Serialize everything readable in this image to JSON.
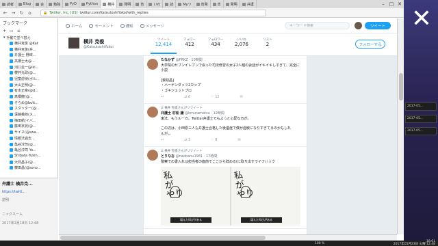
{
  "browser": {
    "tabs": [
      {
        "label": "読者"
      },
      {
        "label": "Blog"
      },
      {
        "label": "会"
      },
      {
        "label": "勉強"
      },
      {
        "label": "PyD"
      },
      {
        "label": "Python"
      },
      {
        "label": "横井"
      },
      {
        "label": "発明"
      },
      {
        "label": "告"
      },
      {
        "label": "いわ"
      },
      {
        "label": "読"
      },
      {
        "label": "Myツ"
      },
      {
        "label": "告発"
      },
      {
        "label": "告"
      },
      {
        "label": "発明"
      },
      {
        "label": "弁護"
      }
    ],
    "url_site": "Twitter, Inc. [US]",
    "url_path": "twitter.com/KatsutoshiYokoi/with_replies"
  },
  "sidebar": {
    "title": "ブックマーク",
    "folder": "手動で並べ替え",
    "items": [
      {
        "label": "横井克俊 @Kat"
      },
      {
        "label": "横井克俊(弁..."
      },
      {
        "label": "弁護士 野田..."
      },
      {
        "label": "高橋士大@..."
      },
      {
        "label": "河口圭一@iki..."
      },
      {
        "label": "櫻井光政(@..."
      },
      {
        "label": "児童虐待(ボル..."
      },
      {
        "label": "大山正明(@..."
      },
      {
        "label": "有本正章(@d..."
      },
      {
        "label": "高橋龍(@..."
      },
      {
        "label": "そらめ@butt..."
      },
      {
        "label": "スタッター(@..."
      },
      {
        "label": "遠藤義郎(ス..."
      },
      {
        "label": "梅田航(イバ..."
      },
      {
        "label": "藤田京晃(@..."
      },
      {
        "label": "サイネ(@swa..."
      },
      {
        "label": "情報法過去..."
      },
      {
        "label": "亀谷淳司(@..."
      },
      {
        "label": "亀谷淳司 Yo..."
      },
      {
        "label": "Shibata Yukin..."
      },
      {
        "label": "大月昌子(@..."
      },
      {
        "label": "藤田昌(@sono..."
      }
    ],
    "panel_title": "弁護士 横井克...",
    "panel_link": "https://twitt...",
    "panel_label1": "説明",
    "panel_label2": "ニックネーム",
    "panel_date": "2017年2月18日 12:48"
  },
  "twitter": {
    "nav_home": "ホーム",
    "nav_moments": "モーメント",
    "nav_notifications": "通知",
    "nav_messages": "メッセージ",
    "search_placeholder": "キーワード検索",
    "tweet_button": "ツイート",
    "profile_name": "横井 克俊",
    "profile_handle": "@KatsutoshiYokoi",
    "stats": [
      {
        "label": "ツイート",
        "value": "12,414"
      },
      {
        "label": "フォロー",
        "value": "412"
      },
      {
        "label": "フォロワー",
        "value": "434"
      },
      {
        "label": "いいね",
        "value": "2,076"
      },
      {
        "label": "リスト",
        "value": "2"
      }
    ],
    "follow_button": "フォローする"
  },
  "tweets": [
    {
      "rt": "",
      "name": "たなかず",
      "handle": "@FRKZ · 10時間",
      "lines": [
        "大学院のセブンイレブンで会った司法修習の女子2人組の会話がイキイキしすぎて、完全に小説",
        "",
        "[救助品]",
        "・ハーゲンダッツ2カップ",
        "・ゴキジェットプロ"
      ],
      "counts": [
        "",
        "6",
        "12"
      ]
    },
    {
      "rt": "横井 克俊さんがリツイート",
      "name": "弁護士 村松 謙",
      "handle": "@kmuramatsu · 12時間",
      "lines": [
        "東法、もうルーカ。Twitter弁護士でもよっと心配な方が。",
        "",
        "この辺は、小田原三人も弁護士合格した後遺症で僕が過敏になりすぎてるのかもしれ",
        "んが。。"
      ],
      "counts": [
        "",
        "3",
        "8"
      ]
    },
    {
      "rt": "横井 克俊さんがリツイート",
      "name": "とりなお",
      "handle": "@naobanu1981 · 17時間",
      "lines": [
        "警察での書入れは担当者の面前でここから辞める(に取り出すライフハック"
      ],
      "counts": [
        "",
        "",
        ""
      ],
      "media_caption": "増えた叫びがある"
    }
  ],
  "taskbar": {
    "zoom": "100 %",
    "time": "18:01",
    "date": "2017年05月23日 火曜 12:48"
  },
  "desktop_widgets": [
    {
      "label": "2017-05..."
    },
    {
      "label": "2017-05..."
    },
    {
      "label": "2017-05..."
    }
  ],
  "chart_data": null
}
